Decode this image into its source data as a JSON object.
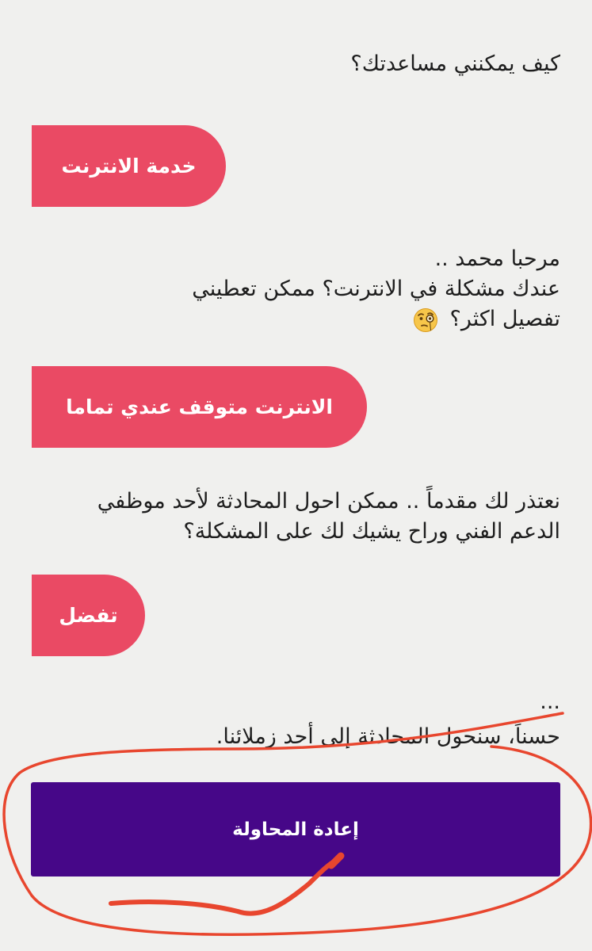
{
  "messages": {
    "bot_greeting": "كيف يمكنني مساعدتك؟",
    "user_choice_1": "خدمة الانترنت",
    "bot_reply_1": {
      "line1": "مرحبا محمد ..",
      "line2": "عندك مشكلة في الانترنت؟ ممكن تعطيني",
      "line3": "تفصيل اكثر؟",
      "emoji": "face-with-monocle-icon"
    },
    "user_choice_2": "الانترنت متوقف عندي تماما",
    "bot_reply_2": {
      "line1": "نعتذر لك مقدماً .. ممكن احول المحادثة لأحد موظفي",
      "line2": "الدعم الفني وراح يشيك لك على المشكلة؟"
    },
    "user_choice_3": "تفضل",
    "bot_reply_3": {
      "typing": "...",
      "text": "حسناً، سنحول المحادثة إلى أحد زملائنا."
    }
  },
  "retry_button": {
    "label": "إعادة المحاولة"
  },
  "colors": {
    "background": "#f0f0ee",
    "user_bubble": "#ea4a64",
    "retry_button": "#460788",
    "annotation": "#e8462e"
  }
}
